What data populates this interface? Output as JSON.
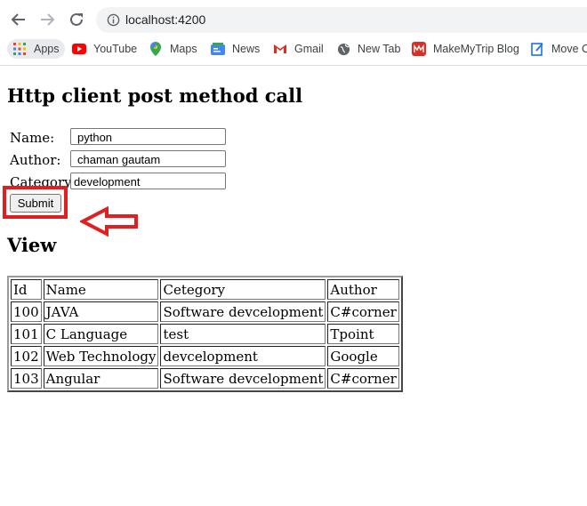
{
  "browser": {
    "url": "localhost:4200",
    "bookmarks": [
      {
        "label": "Apps",
        "icon": "apps-grid-icon"
      },
      {
        "label": "YouTube",
        "icon": "youtube-icon",
        "color": "#ff0000"
      },
      {
        "label": "Maps",
        "icon": "maps-icon"
      },
      {
        "label": "News",
        "icon": "news-icon"
      },
      {
        "label": "Gmail",
        "icon": "gmail-icon",
        "color": "#d93025"
      },
      {
        "label": "New Tab",
        "icon": "globe-icon"
      },
      {
        "label": "MakeMyTrip Blog",
        "icon": "makemytrip-icon",
        "color": "#d93025"
      },
      {
        "label": "Move C",
        "icon": "bookmark-page-icon"
      }
    ]
  },
  "page": {
    "title": "Http client post method call",
    "form": {
      "name_label": "Name:",
      "name_value": "python",
      "author_label": "Author:",
      "author_value": "chaman gautam",
      "category_label": "Category:",
      "category_value": "development",
      "submit_label": "Submit"
    },
    "view_heading": "View",
    "table": {
      "headers": [
        "Id",
        "Name",
        "Cetegory",
        "Author"
      ],
      "rows": [
        [
          "100",
          "JAVA",
          "Software devcelopment",
          "C#corner"
        ],
        [
          "101",
          "C Language",
          "test",
          "Tpoint"
        ],
        [
          "102",
          "Web Technology",
          "devcelopment",
          "Google"
        ],
        [
          "103",
          "Angular",
          "Software devcelopment",
          "C#corner"
        ]
      ]
    }
  },
  "annotation": {
    "highlight_color": "#e02020"
  }
}
